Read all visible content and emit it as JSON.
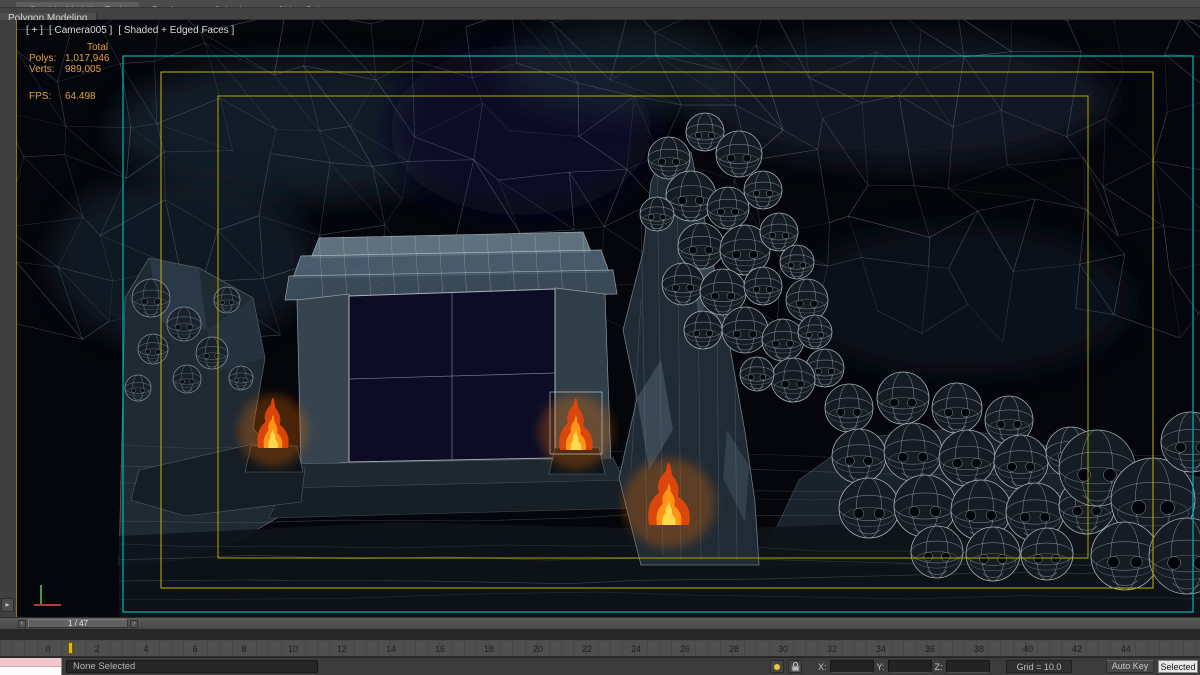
{
  "ribbon": {
    "tabs": [
      {
        "label": "Graphite Modeling Tools",
        "active": true
      },
      {
        "label": "Freeform",
        "active": false
      },
      {
        "label": "Selection",
        "active": false
      },
      {
        "label": "Object Paint",
        "active": false
      }
    ],
    "panel_tab": "Polygon Modeling"
  },
  "viewport": {
    "menu_plus": "[ + ]",
    "menu_camera": "[ Camera005 ]",
    "menu_shading": "[ Shaded + Edged Faces ]",
    "stats": {
      "total_label": "Total",
      "polys_label": "Polys:",
      "polys_value": "1,017,946",
      "verts_label": "Verts:",
      "verts_value": "989,005",
      "fps_label": "FPS:",
      "fps_value": "64.498"
    }
  },
  "timeline": {
    "time_slider_value": "1 / 47",
    "frame_labels": [
      "0",
      "2",
      "4",
      "6",
      "8",
      "10",
      "12",
      "14",
      "16",
      "18",
      "20",
      "22",
      "24",
      "26",
      "28",
      "30",
      "32",
      "34",
      "36",
      "38",
      "40",
      "42",
      "44"
    ]
  },
  "status_bar": {
    "selection_status": "None Selected",
    "coord_x_label": "X:",
    "coord_y_label": "Y:",
    "coord_z_label": "Z:",
    "grid_label": "Grid = 10.0",
    "auto_key_label": "Auto Key",
    "selection_set_value": "Selected"
  },
  "colors": {
    "safe_frame_live": "#00b6b6",
    "safe_frame_action": "#c7b400",
    "stats_text": "#e2a23c",
    "wireframe": "#8a95a1",
    "fire_outer": "#e0470a",
    "fire_mid": "#ff9415",
    "fire_core": "#ffd94f"
  }
}
